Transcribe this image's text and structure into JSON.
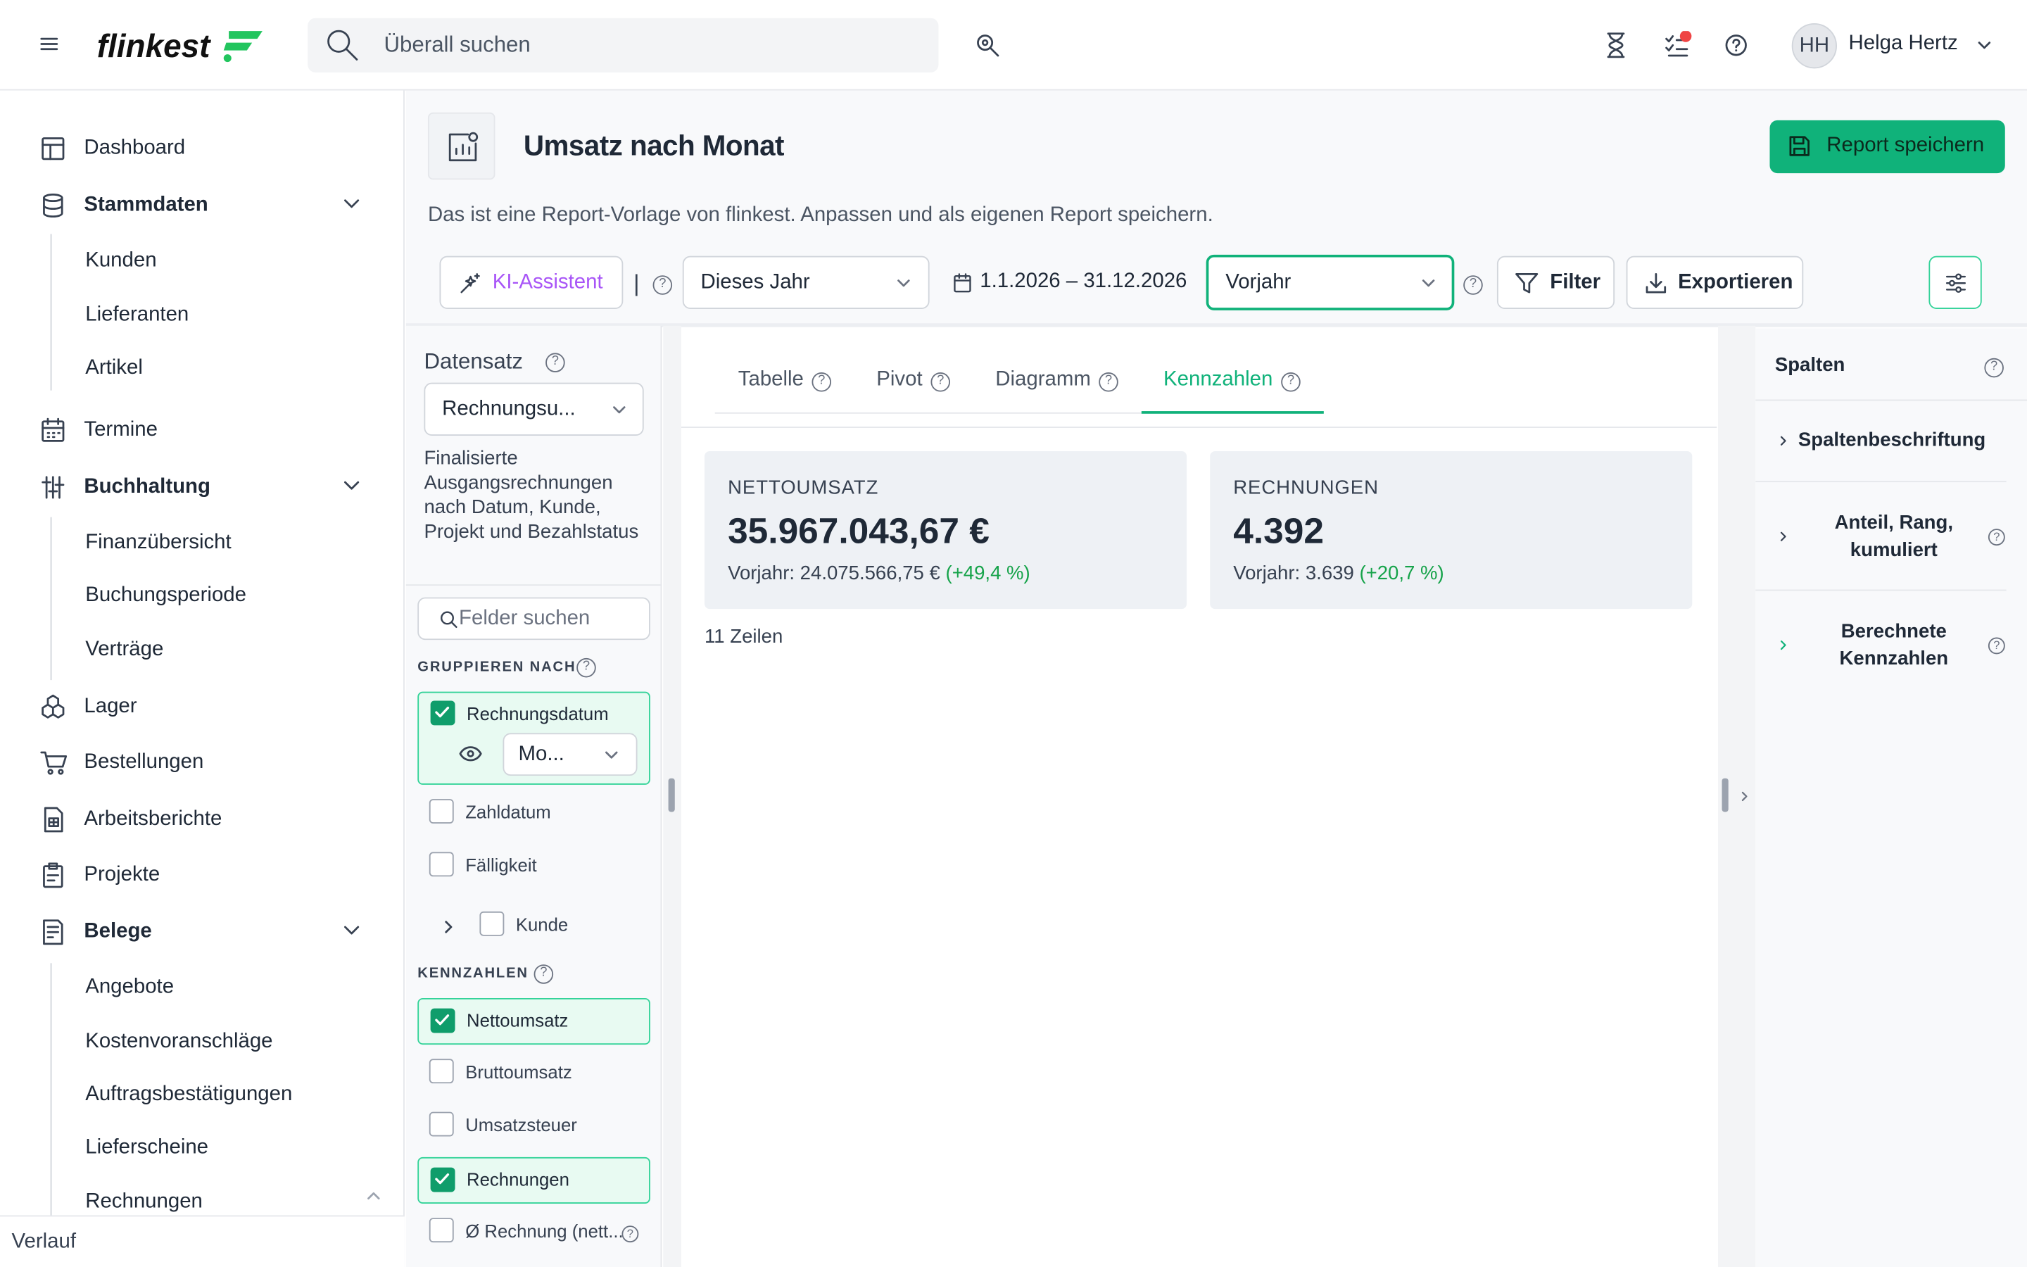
{
  "topbar": {
    "search_placeholder": "Überall suchen",
    "user_initials": "HH",
    "user_name": "Helga Hertz"
  },
  "sidebar": {
    "items": [
      {
        "label": "Dashboard",
        "icon": "dashboard-icon"
      },
      {
        "label": "Stammdaten",
        "icon": "database-icon",
        "expanded": true
      },
      {
        "label": "Kunden"
      },
      {
        "label": "Lieferanten"
      },
      {
        "label": "Artikel"
      },
      {
        "label": "Termine",
        "icon": "calendar-icon"
      },
      {
        "label": "Buchhaltung",
        "icon": "sliders-icon",
        "expanded": true
      },
      {
        "label": "Finanzübersicht"
      },
      {
        "label": "Buchungsperiode"
      },
      {
        "label": "Verträge"
      },
      {
        "label": "Lager",
        "icon": "boxes-icon"
      },
      {
        "label": "Bestellungen",
        "icon": "cart-icon"
      },
      {
        "label": "Arbeitsberichte",
        "icon": "report-icon"
      },
      {
        "label": "Projekte",
        "icon": "clipboard-icon"
      },
      {
        "label": "Belege",
        "icon": "receipt-icon",
        "expanded": true
      },
      {
        "label": "Angebote"
      },
      {
        "label": "Kostenvoranschläge"
      },
      {
        "label": "Auftragsbestätigungen"
      },
      {
        "label": "Lieferscheine"
      },
      {
        "label": "Rechnungen"
      }
    ],
    "footer": "Verlauf"
  },
  "header": {
    "title": "Umsatz nach Monat",
    "save_button": "Report speichern",
    "description": "Das ist eine Report-Vorlage von flinkest. Anpassen und als eigenen Report speichern."
  },
  "toolbar": {
    "ai_button": "KI-Assistent",
    "separator": "|",
    "period_select": "Dieses Jahr",
    "date_range": "1.1.2026 – 31.12.2026",
    "compare_select": "Vorjahr",
    "filter_button": "Filter",
    "export_button": "Exportieren"
  },
  "dataset": {
    "heading": "Datensatz",
    "select_value": "Rechnungsu...",
    "description": "Finalisierte Ausgangsrechnungen nach Datum, Kunde, Projekt und Bezahlstatus",
    "field_search_placeholder": "Felder suchen",
    "group_heading": "GRUPPIEREN NACH",
    "group_fields": [
      {
        "label": "Rechnungsdatum",
        "checked": true,
        "sub_select": "Mo..."
      },
      {
        "label": "Zahldatum",
        "checked": false
      },
      {
        "label": "Fälligkeit",
        "checked": false
      },
      {
        "label": "Kunde",
        "checked": false
      }
    ],
    "metrics_heading": "KENNZAHLEN",
    "metric_fields": [
      {
        "label": "Nettoumsatz",
        "checked": true
      },
      {
        "label": "Bruttoumsatz",
        "checked": false
      },
      {
        "label": "Umsatzsteuer",
        "checked": false
      },
      {
        "label": "Rechnungen",
        "checked": true
      },
      {
        "label": "Ø Rechnung (nett...",
        "checked": false
      }
    ]
  },
  "view_tabs": [
    {
      "label": "Tabelle",
      "active": false
    },
    {
      "label": "Pivot",
      "active": false
    },
    {
      "label": "Diagramm",
      "active": false
    },
    {
      "label": "Kennzahlen",
      "active": true
    }
  ],
  "kpis": [
    {
      "title": "NETTOUMSATZ",
      "value": "35.967.043,67 €",
      "prev": "Vorjahr: 24.075.566,75 €",
      "delta": "(+49,4 %)"
    },
    {
      "title": "RECHNUNGEN",
      "value": "4.392",
      "prev": "Vorjahr: 3.639",
      "delta": "(+20,7 %)"
    }
  ],
  "row_count": "11 Zeilen",
  "columns_panel": {
    "heading": "Spalten",
    "items": [
      "Spaltenbeschriftung",
      "Anteil, Rang, kumuliert",
      "Berechnete Kennzahlen"
    ]
  },
  "colors": {
    "accent": "#10b27a",
    "positive": "#16a34a",
    "ai": "#a855f7"
  }
}
